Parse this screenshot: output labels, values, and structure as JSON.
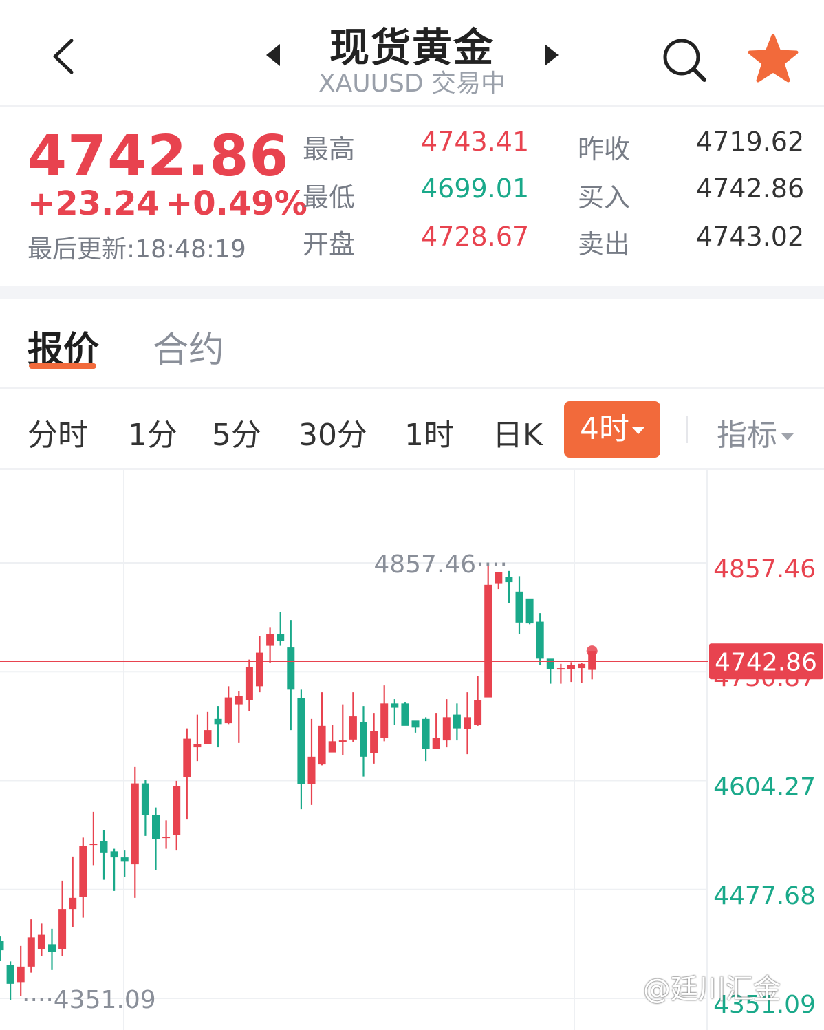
{
  "header": {
    "title": "现货黄金",
    "subtitle": "XAUUSD 交易中"
  },
  "quote": {
    "price": "4742.86",
    "change": "+23.24",
    "change_pct": "+0.49%",
    "updated": "最后更新:18:48:19",
    "stats": [
      {
        "label": "最高",
        "value": "4743.41",
        "tone": "red"
      },
      {
        "label": "最低",
        "value": "4699.01",
        "tone": "green"
      },
      {
        "label": "开盘",
        "value": "4728.67",
        "tone": "red"
      },
      {
        "label": "昨收",
        "value": "4719.62",
        "tone": "dark"
      },
      {
        "label": "买入",
        "value": "4742.86",
        "tone": "dark"
      },
      {
        "label": "卖出",
        "value": "4743.02",
        "tone": "dark"
      }
    ]
  },
  "tabs": {
    "quote": "报价",
    "contract": "合约"
  },
  "periods": [
    "分时",
    "1分",
    "5分",
    "30分",
    "1时",
    "日K"
  ],
  "active_period": "4时",
  "indicator_label": "指标",
  "colors": {
    "up": "#e8434f",
    "down": "#1aa98a",
    "accent": "#f26a3b"
  },
  "watermark": "@廷川汇金",
  "chart_data": {
    "type": "candlestick",
    "y_labels": [
      {
        "value": 4857.46,
        "text": "4857.46",
        "tone": "red"
      },
      {
        "value": 4730.87,
        "text": "4730.87",
        "tone": "red"
      },
      {
        "value": 4604.27,
        "text": "4604.27",
        "tone": "green"
      },
      {
        "value": 4477.68,
        "text": "4477.68",
        "tone": "green"
      },
      {
        "value": 4351.09,
        "text": "4351.09",
        "tone": "green"
      }
    ],
    "current": {
      "value": 4742.86,
      "text": "4742.86"
    },
    "high_marker": {
      "value": 4857.46,
      "text": "4857.46"
    },
    "low_marker": {
      "value": 4351.09,
      "text": "4351.09"
    },
    "ylim": [
      4351.09,
      4857.46
    ],
    "candles": [
      [
        4418,
        4407,
        4423,
        4395
      ],
      [
        4390,
        4368,
        4394,
        4349
      ],
      [
        4370,
        4388,
        4412,
        4354
      ],
      [
        4388,
        4422,
        4443,
        4381
      ],
      [
        4408,
        4425,
        4438,
        4400
      ],
      [
        4414,
        4405,
        4432,
        4384
      ],
      [
        4408,
        4455,
        4488,
        4400
      ],
      [
        4455,
        4468,
        4516,
        4434
      ],
      [
        4469,
        4528,
        4538,
        4445
      ],
      [
        4530,
        4531,
        4568,
        4506
      ],
      [
        4534,
        4520,
        4547,
        4489
      ],
      [
        4522,
        4515,
        4525,
        4476
      ],
      [
        4515,
        4510,
        4523,
        4492
      ],
      [
        4507,
        4601,
        4620,
        4468
      ],
      [
        4601,
        4564,
        4605,
        4540
      ],
      [
        4564,
        4536,
        4573,
        4500
      ],
      [
        4539,
        4539,
        4558,
        4525
      ],
      [
        4541,
        4598,
        4604,
        4523
      ],
      [
        4608,
        4653,
        4665,
        4559
      ],
      [
        4643,
        4647,
        4681,
        4627
      ],
      [
        4647,
        4663,
        4684,
        4647
      ],
      [
        4676,
        4670,
        4691,
        4643
      ],
      [
        4671,
        4701,
        4714,
        4670
      ],
      [
        4693,
        4703,
        4708,
        4648
      ],
      [
        4698,
        4736,
        4745,
        4685
      ],
      [
        4714,
        4753,
        4772,
        4707
      ],
      [
        4761,
        4775,
        4782,
        4741
      ],
      [
        4775,
        4767,
        4800,
        4761
      ],
      [
        4759,
        4710,
        4791,
        4663
      ],
      [
        4700,
        4600,
        4710,
        4571
      ],
      [
        4600,
        4632,
        4676,
        4576
      ],
      [
        4623,
        4668,
        4707,
        4622
      ],
      [
        4637,
        4650,
        4669,
        4638
      ],
      [
        4651,
        4651,
        4693,
        4634
      ],
      [
        4652,
        4679,
        4707,
        4649
      ],
      [
        4672,
        4632,
        4691,
        4609
      ],
      [
        4636,
        4662,
        4683,
        4624
      ],
      [
        4654,
        4694,
        4715,
        4650
      ],
      [
        4694,
        4689,
        4699,
        4669
      ],
      [
        4694,
        4668,
        4695,
        4677
      ],
      [
        4674,
        4666,
        4672,
        4660
      ],
      [
        4676,
        4641,
        4678,
        4627
      ],
      [
        4641,
        4654,
        4683,
        4645
      ],
      [
        4651,
        4678,
        4699,
        4643
      ],
      [
        4681,
        4665,
        4694,
        4651
      ],
      [
        4664,
        4678,
        4707,
        4635
      ],
      [
        4669,
        4698,
        4726,
        4668
      ],
      [
        4701,
        4832,
        4857,
        4800
      ],
      [
        4833,
        4847,
        4845,
        4827
      ],
      [
        4841,
        4835,
        4848,
        4811
      ],
      [
        4824,
        4788,
        4842,
        4775
      ],
      [
        4816,
        4787,
        4814,
        4786
      ],
      [
        4789,
        4746,
        4799,
        4739
      ],
      [
        4746,
        4734,
        4745,
        4717
      ],
      [
        4734,
        4735,
        4740,
        4717
      ],
      [
        4734,
        4739,
        4742,
        4719
      ],
      [
        4735,
        4740,
        4741,
        4718
      ],
      [
        4733,
        4755,
        4754,
        4722
      ]
    ]
  }
}
